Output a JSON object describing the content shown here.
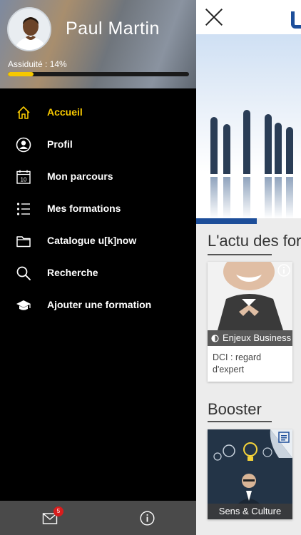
{
  "profile": {
    "name": "Paul Martin",
    "attendance_label": "Assiduité : 14%",
    "attendance_progress": 0.14
  },
  "menu": {
    "items": [
      {
        "label": "Accueil",
        "icon": "home-icon",
        "active": true
      },
      {
        "label": "Profil",
        "icon": "user-circle-icon"
      },
      {
        "label": "Mon parcours",
        "icon": "calendar-icon",
        "icon_text": "10"
      },
      {
        "label": "Mes formations",
        "icon": "list-icon"
      },
      {
        "label": "Catalogue u[k]now",
        "icon": "folder-icon"
      },
      {
        "label": "Recherche",
        "icon": "search-icon"
      },
      {
        "label": "Ajouter une formation",
        "icon": "graduation-cap-icon"
      }
    ]
  },
  "footer": {
    "mail_badge": "5",
    "mail_icon": "mail-icon",
    "info_icon": "info-icon"
  },
  "main": {
    "section1_title": "L'actu des for",
    "card1": {
      "tag": "Enjeux Business",
      "description": "DCI : regard d'expert"
    },
    "section2_title": "Booster",
    "card2": {
      "tag": "Sens & Culture"
    }
  },
  "colors": {
    "accent": "#f6c800",
    "brand": "#1d4e9a",
    "drawer_bg": "#000000",
    "footer_bg": "#4a4a4a",
    "badge": "#d91d1d"
  }
}
